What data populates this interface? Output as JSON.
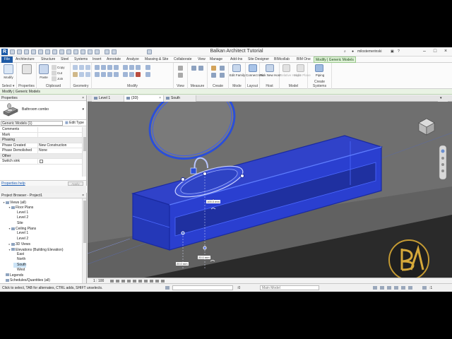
{
  "app": {
    "title": "Balkan Architect Tutorial",
    "user": "milostemerinski",
    "colors": {
      "accent": "#1e5aa5",
      "context_tab": "#dff1d8",
      "selection": "#2b4fd8"
    }
  },
  "menu": {
    "file": "File",
    "tabs": [
      "Architecture",
      "Structure",
      "Steel",
      "Systems",
      "Insert",
      "Annotate",
      "Analyze",
      "Massing & Site",
      "Collaborate",
      "View",
      "Manage",
      "Add-Ins",
      "Site Designer",
      "BIMcollab",
      "BIM One"
    ],
    "active_tab": "Modify | Generic Models"
  },
  "ribbon": {
    "modify": "Modify",
    "clipboard": {
      "paste": "Paste",
      "copy": "Copy",
      "cut": "Cut",
      "join": "Join"
    },
    "family": {
      "edit": "Edit Family"
    },
    "connect": "Connect Into",
    "pick_host": "Pick New Host",
    "relative_host": "Relative Height",
    "make_plane": "Make Plane",
    "piping": "Piping",
    "panels": [
      "Select",
      "Properties",
      "Clipboard",
      "Geometry",
      "Modify",
      "View",
      "Measure",
      "Create",
      "Mode",
      "Layout",
      "Host",
      "Model",
      "Create Systems"
    ],
    "select_dropdown": "Select ▾"
  },
  "context_bar": {
    "label": "Modify | Generic Models"
  },
  "properties": {
    "title": "Properties",
    "type_name": "Bathroom combo",
    "instance_selector": "Generic Models (1)",
    "edit_type": "Edit Type",
    "rows": [
      {
        "key": "Comments",
        "value": "",
        "group": false
      },
      {
        "key": "Mark",
        "value": "",
        "group": false
      },
      {
        "key": "Phasing",
        "value": "",
        "group": true
      },
      {
        "key": "Phase Created",
        "value": "New Construction",
        "group": false
      },
      {
        "key": "Phase Demolished",
        "value": "None",
        "group": false
      },
      {
        "key": "Other",
        "value": "",
        "group": true
      },
      {
        "key": "Switch sink",
        "value": "",
        "group": false,
        "checkbox": true
      }
    ],
    "help_link": "Properties help",
    "apply": "Apply"
  },
  "browser": {
    "title": "Project Browser - Project1",
    "nodes": [
      {
        "label": "Views (all)",
        "level": 0,
        "exp": "−"
      },
      {
        "label": "Floor Plans",
        "level": 1,
        "exp": "−"
      },
      {
        "label": "Level 1",
        "level": 2,
        "exp": ""
      },
      {
        "label": "Level 2",
        "level": 2,
        "exp": ""
      },
      {
        "label": "Site",
        "level": 2,
        "exp": ""
      },
      {
        "label": "Ceiling Plans",
        "level": 1,
        "exp": "−"
      },
      {
        "label": "Level 1",
        "level": 2,
        "exp": ""
      },
      {
        "label": "Level 2",
        "level": 2,
        "exp": ""
      },
      {
        "label": "3D Views",
        "level": 1,
        "exp": "+"
      },
      {
        "label": "Elevations (Building Elevation)",
        "level": 1,
        "exp": "−"
      },
      {
        "label": "East",
        "level": 2,
        "exp": ""
      },
      {
        "label": "North",
        "level": 2,
        "exp": ""
      },
      {
        "label": "South",
        "level": 2,
        "exp": "",
        "selected": true
      },
      {
        "label": "West",
        "level": 2,
        "exp": ""
      },
      {
        "label": "Legends",
        "level": 0,
        "exp": ""
      },
      {
        "label": "Schedules/Quantities (all)",
        "level": 0,
        "exp": ""
      }
    ]
  },
  "view_tabs": [
    {
      "label": "Level 1",
      "active": false
    },
    {
      "label": "{3D}",
      "active": true
    },
    {
      "label": "South",
      "active": false
    }
  ],
  "canvas": {
    "dimensions": [
      "100.0 mm",
      "20.0 mm",
      "20.0 mm"
    ]
  },
  "view_bar": {
    "scale": "1 : 100"
  },
  "status": {
    "message": "Click to select, TAB for alternates, CTRL adds, SHIFT unselects.",
    "workset": "Main Model",
    "zero": ":0"
  }
}
